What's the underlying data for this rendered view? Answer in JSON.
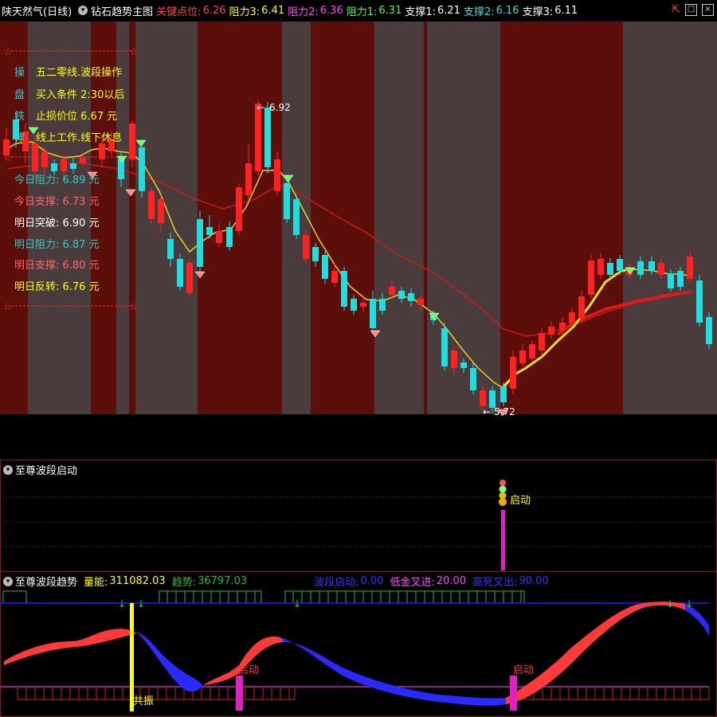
{
  "header": {
    "stock_title": "陕天然气(日线)",
    "indicator_title": "钻石趋势主图",
    "key_point_label": "关键点位:",
    "key_point_value": "6.26",
    "r3_label": "阻力3:",
    "r3_value": "6.41",
    "r2_label": "阻力2:",
    "r2_value": "6.36",
    "r1_label": "阻力1:",
    "r1_value": "6.31",
    "s1_label": "支撑1:",
    "s1_value": "6.21",
    "s2_label": "支撑2:",
    "s2_value": "6.16",
    "s3_label": "支撑3:",
    "s3_value": "6.11",
    "window_icons": [
      "pin-icon",
      "maximize-icon",
      "close-icon"
    ]
  },
  "overlay": {
    "rows": [
      {
        "char": "操",
        "text": "五二零线.波段操作",
        "color": "#ffff00"
      },
      {
        "char": "盘",
        "text": "买入条件 2:30以后",
        "color": "#ffff00"
      },
      {
        "char": "铁",
        "text": "止损价位 6.67 元",
        "color": "#ffff00"
      },
      {
        "char": "律",
        "text": "线上工作.线下休息",
        "color": "#ffff00"
      }
    ],
    "levels": [
      {
        "text": "今日阻力:  6.89 元",
        "color": "#33cccc"
      },
      {
        "text": "今日支撑:  6.73 元",
        "color": "#ff6666"
      },
      {
        "text": "明日突破:  6.90 元",
        "color": "#ffffff"
      },
      {
        "text": "明日阻力:  6.87 元",
        "color": "#33cccc"
      },
      {
        "text": "明日支撑:  6.80 元",
        "color": "#ff6666"
      },
      {
        "text": "明日反转:  6.76 元",
        "color": "#ffff00"
      }
    ],
    "high_label": "6.92",
    "low_label": "5.72"
  },
  "panel2": {
    "title": "至尊波段启动",
    "signal_label": "启动"
  },
  "panel3": {
    "title": "至尊波段趋势",
    "energy_label": "量能:",
    "energy_value": "311082.03",
    "trend_label": "趋势:",
    "trend_value": "36797.03",
    "wave_label": "波段启动:",
    "wave_value": "0.00",
    "low_label": "低金叉进:",
    "low_value": "20.00",
    "high_label": "高死叉出:",
    "high_value": "90.00",
    "resonance_label": "共振",
    "start_label_1": "启动",
    "start_label_2": "启动"
  },
  "colors": {
    "up": "#ff2222",
    "down": "#22dddd",
    "bg_red": "#5c0f0a",
    "bg_gray": "#4a3c3c",
    "panel_border": "#8a1a1a"
  }
}
